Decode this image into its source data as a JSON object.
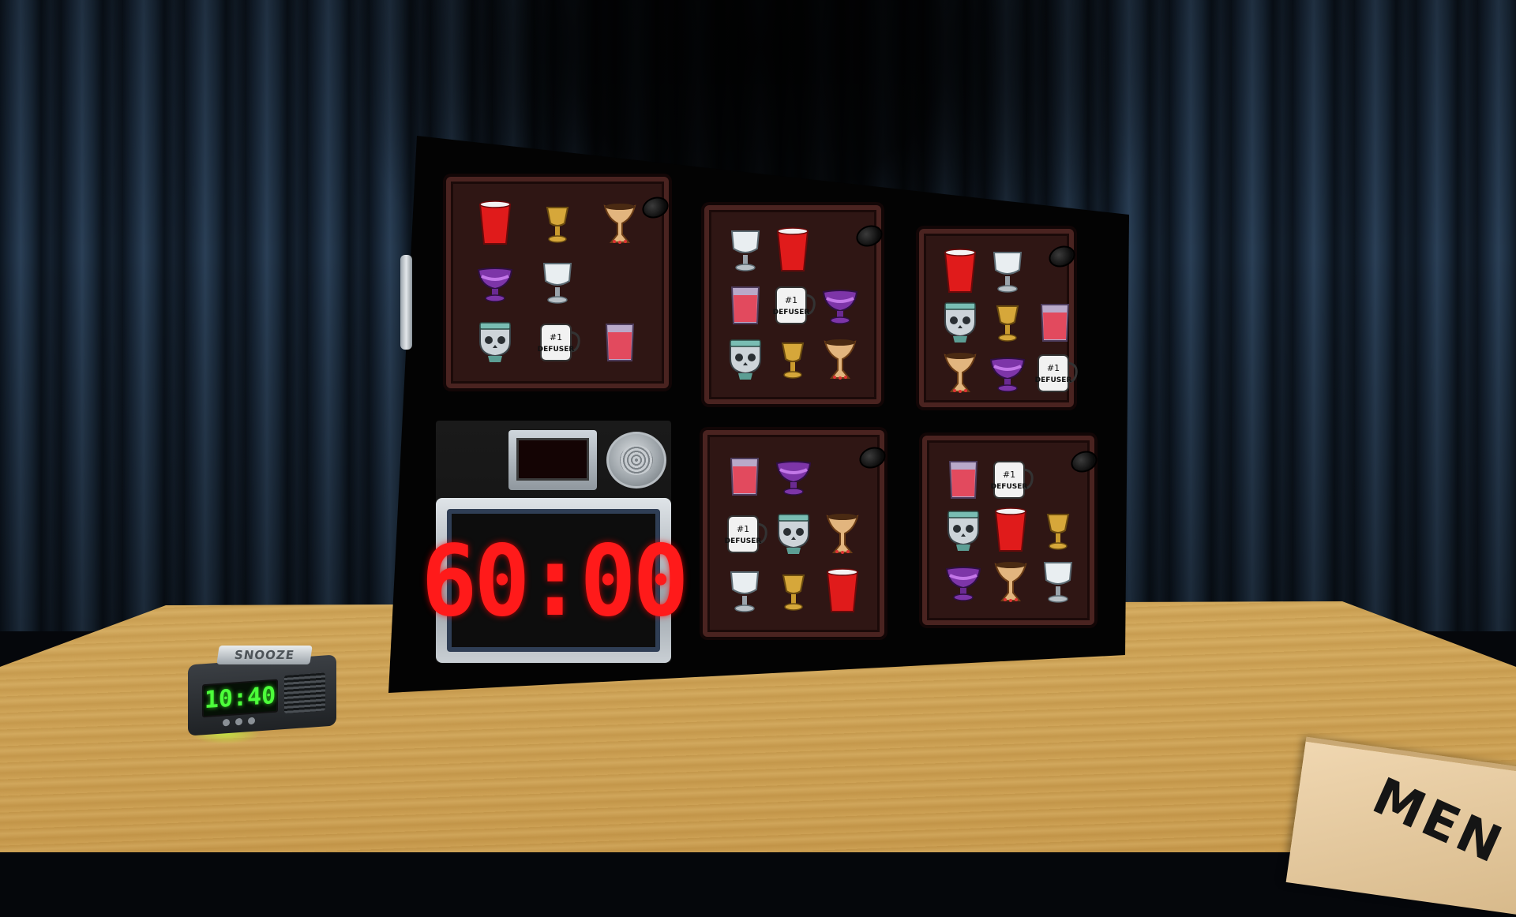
{
  "scene": {
    "timer": {
      "display": "60:00"
    },
    "strike_indicator": {
      "display": ""
    },
    "alarm_clock": {
      "snooze_label": "SNOOZE",
      "time": "10:40"
    },
    "manual": {
      "label": "MEN"
    },
    "mug_text": {
      "line1": "#1",
      "line2": "DEFUSER"
    }
  },
  "modules": [
    {
      "id": "module-1",
      "cups": [
        "red-cup",
        "gold-goblet",
        "grail",
        "purple-chalice",
        "white-goblet",
        "",
        "skull-cup",
        "defuser-mug",
        "juice-glass"
      ]
    },
    {
      "id": "module-2",
      "cups": [
        "white-goblet",
        "red-cup",
        "",
        "juice-glass",
        "defuser-mug",
        "purple-chalice",
        "skull-cup",
        "gold-goblet",
        "grail"
      ]
    },
    {
      "id": "module-3",
      "cups": [
        "red-cup",
        "white-goblet",
        "",
        "skull-cup",
        "gold-goblet",
        "juice-glass",
        "grail",
        "purple-chalice",
        "defuser-mug"
      ]
    },
    {
      "id": "module-4",
      "cups": [
        "juice-glass",
        "purple-chalice",
        "",
        "defuser-mug",
        "skull-cup",
        "grail",
        "white-goblet",
        "gold-goblet",
        "red-cup"
      ]
    },
    {
      "id": "module-5",
      "cups": [
        "juice-glass",
        "defuser-mug",
        "",
        "skull-cup",
        "red-cup",
        "gold-goblet",
        "purple-chalice",
        "grail",
        "white-goblet"
      ]
    }
  ],
  "colors": {
    "timer_red": "#ff1a1a",
    "clock_green": "#4cff3a",
    "module_bg": "#2f1614"
  }
}
